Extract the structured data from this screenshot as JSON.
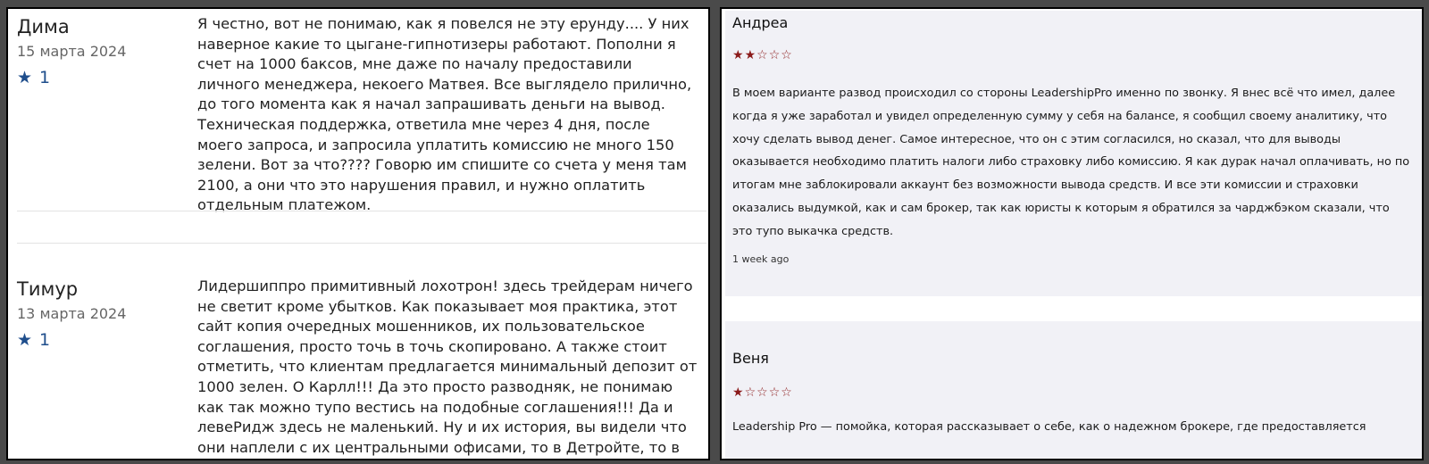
{
  "left_reviews": [
    {
      "name": "Дима",
      "date": "15 марта 2024",
      "rating": "1",
      "text": "Я честно, вот не понимаю, как я повелся не эту ерунду.... У них наверное какие то цыгане-гипнотизеры работают. Пополни я счет на 1000 баксов, мне даже по началу предоставили личного менеджера, некоего Матвея. Все выглядело прилично, до того момента как я начал запрашивать деньги на вывод. Техническая поддержка, ответила мне через 4 дня, после моего запроса, и запросила уплатить комиссию не много 150 зелени. Вот за что???? Говорю им спишите со счета у меня там 2100, а они что это нарушения правил, и нужно оплатить отдельным платежом."
    },
    {
      "name": "Тимур",
      "date": "13 марта 2024",
      "rating": "1",
      "text": "Лидершиппро примитивный лохотрон! здесь трейдерам ничего не светит кроме убытков. Как показывает моя практика, этот сайт копия очередных мошенников, их пользовательское соглашения, просто точь в точь скопировано. А также стоит отметить, что клиентам предлагается минимальный депозит от 1000 зелен. О Карлл!!! Да это просто разводняк, не понимаю как так можно тупо вестись на подобные соглашения!!! Да и левеРидж здесь не маленький. Ну и их история, вы видели что они наплели с их центральными офисами, то в Детройте, то в Нью Йорке, тов Монако.. Манипуляторы хреновы!!!"
    }
  ],
  "right_reviews": [
    {
      "name": "Андреа",
      "stars_filled": 2,
      "stars_total": 5,
      "text": "В моем варианте развод происходил со стороны LeadershipPro именно по звонку. Я внес всё что имел, далее когда я уже заработал и увидел определенную сумму у себя на балансе, я сообщил своему аналитику, что хочу сделать вывод денег. Самое интересное, что он с этим согласился, но сказал, что для выводы оказывается необходимо платить налоги либо страховку либо комиссию. Я как дурак начал оплачивать, но по итогам мне заблокировали аккаунт без возможности вывода средств. И все эти комиссии и страховки оказались выдумкой, как и сам брокер, так как юристы к которым я обратился за чарджбэком сказали, что это тупо выкачка средств.",
      "time": "1 week ago"
    },
    {
      "name": "Веня",
      "stars_filled": 1,
      "stars_total": 5,
      "text": "Leadership Pro — помойка, которая рассказывает о себе, как о надежном брокере, где предоставляется"
    }
  ],
  "icons": {
    "star_filled": "★",
    "star_empty": "☆"
  },
  "colors": {
    "rating_blue": "#1f4e8c",
    "star_red": "#8b1a1a",
    "card_bg": "#f1f1f6"
  }
}
